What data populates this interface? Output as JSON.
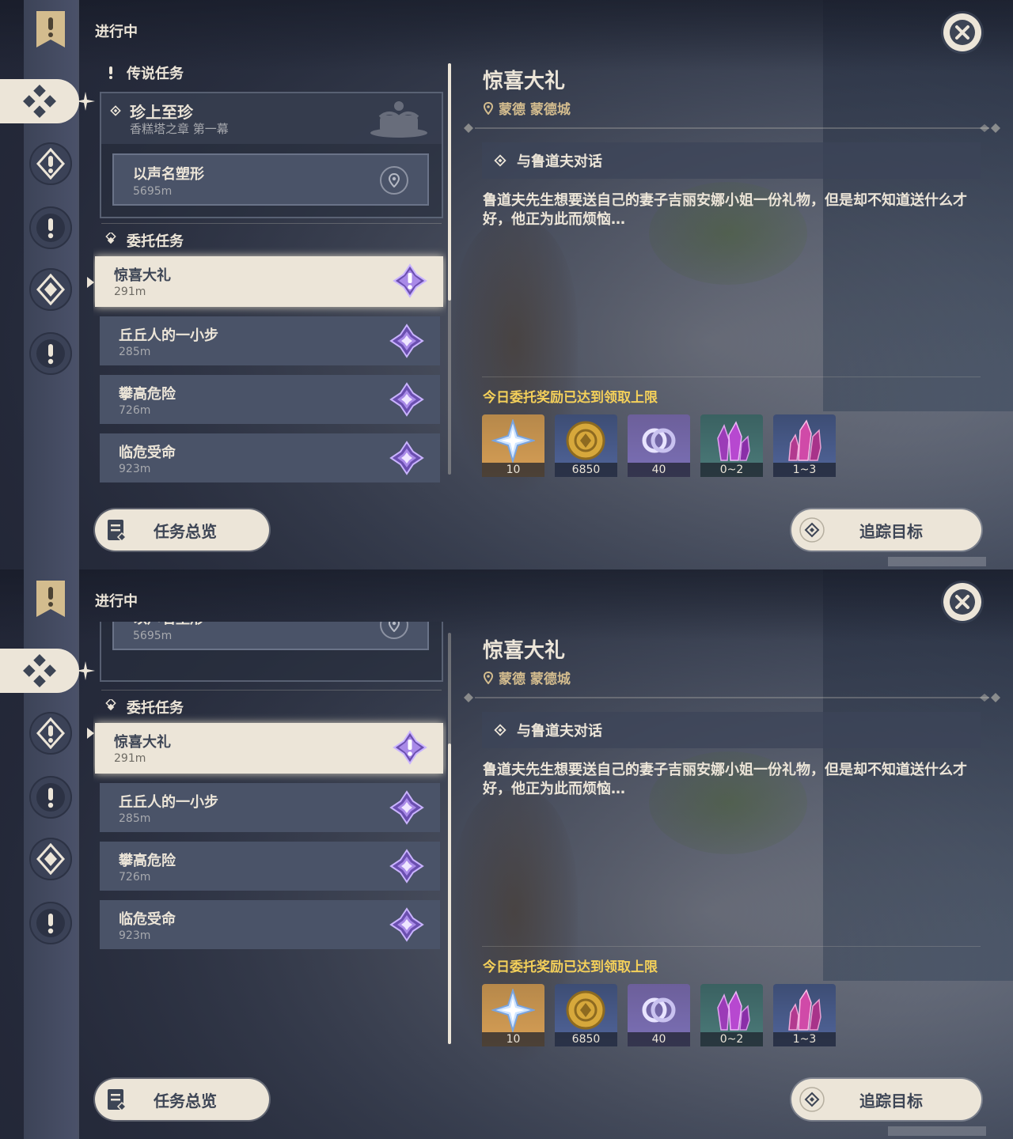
{
  "panels": [
    {
      "nav": {
        "active": "commissions"
      },
      "header": {
        "status": "进行中"
      },
      "legend_section": {
        "header": "传说任务",
        "quest": {
          "title": "珍上至珍",
          "subtitle": "香糕塔之章 第一幕"
        },
        "step": {
          "title": "以声名塑形",
          "distance": "5695m"
        }
      },
      "commission_section": {
        "header": "委托任务",
        "quests": [
          {
            "title": "惊喜大礼",
            "distance": "291m",
            "selected": true
          },
          {
            "title": "丘丘人的一小步",
            "distance": "285m"
          },
          {
            "title": "攀高危险",
            "distance": "726m"
          },
          {
            "title": "临危受命",
            "distance": "923m"
          }
        ]
      },
      "detail": {
        "title": "惊喜大礼",
        "location": "蒙德 蒙德城",
        "objective": "与鲁道夫对话",
        "description": "鲁道夫先生想要送自己的妻子吉丽安娜小姐一份礼物，但是却不知道送什么才好，他正为此而烦恼…",
        "reward_note": "今日委托奖励已达到领取上限",
        "rewards": [
          {
            "icon": "primogem-icon",
            "count": "10",
            "rarity": "r4"
          },
          {
            "icon": "mora-icon",
            "count": "6850",
            "rarity": "r3"
          },
          {
            "icon": "adventure-exp-icon",
            "count": "40",
            "rarity": "r3p"
          },
          {
            "icon": "crystal-ore-icon",
            "count": "0~2",
            "rarity": "r2"
          },
          {
            "icon": "crystal-chunk-icon",
            "count": "1~3",
            "rarity": "r3"
          }
        ]
      },
      "buttons": {
        "overview": "任务总览",
        "track": "追踪目标"
      }
    },
    {
      "nav": {
        "active": "commissions"
      },
      "header": {
        "status": "进行中"
      },
      "legend_section": {
        "step": {
          "title": "以声名塑形",
          "distance": "5695m"
        }
      },
      "commission_section": {
        "header": "委托任务",
        "quests": [
          {
            "title": "惊喜大礼",
            "distance": "291m",
            "selected": true
          },
          {
            "title": "丘丘人的一小步",
            "distance": "285m"
          },
          {
            "title": "攀高危险",
            "distance": "726m"
          },
          {
            "title": "临危受命",
            "distance": "923m"
          }
        ]
      },
      "detail": {
        "title": "惊喜大礼",
        "location": "蒙德 蒙德城",
        "objective": "与鲁道夫对话",
        "description": "鲁道夫先生想要送自己的妻子吉丽安娜小姐一份礼物，但是却不知道送什么才好，他正为此而烦恼…",
        "reward_note": "今日委托奖励已达到领取上限",
        "rewards": [
          {
            "icon": "primogem-icon",
            "count": "10",
            "rarity": "r4"
          },
          {
            "icon": "mora-icon",
            "count": "6850",
            "rarity": "r3"
          },
          {
            "icon": "adventure-exp-icon",
            "count": "40",
            "rarity": "r3p"
          },
          {
            "icon": "crystal-ore-icon",
            "count": "0~2",
            "rarity": "r2"
          },
          {
            "icon": "crystal-chunk-icon",
            "count": "1~3",
            "rarity": "r3"
          }
        ]
      },
      "buttons": {
        "overview": "任务总览",
        "track": "追踪目标"
      }
    }
  ]
}
